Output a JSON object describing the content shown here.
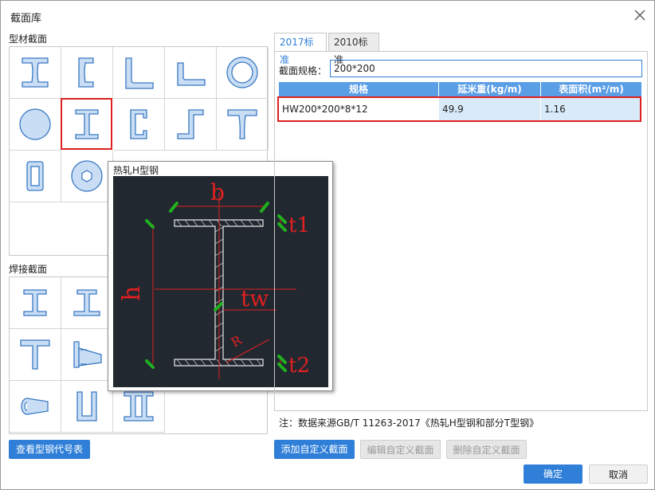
{
  "window": {
    "title": "截面库"
  },
  "left": {
    "profile_section_label": "型材截面",
    "welded_section_label": "焊接截面",
    "view_code_table_button": "查看型钢代号表",
    "profile_shapes": [
      "h-beam-icon",
      "channel-icon",
      "equal-angle-icon",
      "unequal-angle-icon",
      "pipe-icon",
      "round-bar-icon",
      "hot-rolled-h-icon",
      "c-channel-icon",
      "z-section-icon",
      "t-section-icon",
      "rect-tube-icon",
      "hex-bar-icon"
    ],
    "welded_shapes": [
      "welded-i-icon",
      "welded-i-asym-icon",
      "welded-t-icon",
      "welded-tapered-i-icon",
      "welded-cone-icon",
      "welded-u-box-icon",
      "welded-double-i-icon"
    ]
  },
  "preview": {
    "title": "热轧H型钢",
    "labels": {
      "b": "b",
      "h": "h",
      "t1": "t1",
      "tw": "tw",
      "t2": "t2",
      "R": "R"
    }
  },
  "tabs": [
    {
      "label": "2017标准",
      "active": true
    },
    {
      "label": "2010标准",
      "active": false
    }
  ],
  "filter": {
    "label": "截面规格：",
    "value": "200*200"
  },
  "table": {
    "headers": [
      "规格",
      "延米重(kg/m)",
      "表面积(m²/m)"
    ],
    "rows": [
      [
        "HW200*200*8*12",
        "49.9",
        "1.16"
      ]
    ]
  },
  "note": "注：数据来源GB/T 11263-2017《热轧H型钢和部分T型钢》",
  "actions": {
    "add": "添加自定义截面",
    "edit": "编辑自定义截面",
    "delete": "删除自定义截面"
  },
  "footer": {
    "ok": "确定",
    "cancel": "取消"
  },
  "colors": {
    "accent": "#2f7fd8",
    "icon_fill": "#c9def5",
    "icon_stroke": "#3a78c2",
    "selection": "#e02020",
    "drawing_red": "#e02020",
    "drawing_green": "#20b020"
  }
}
